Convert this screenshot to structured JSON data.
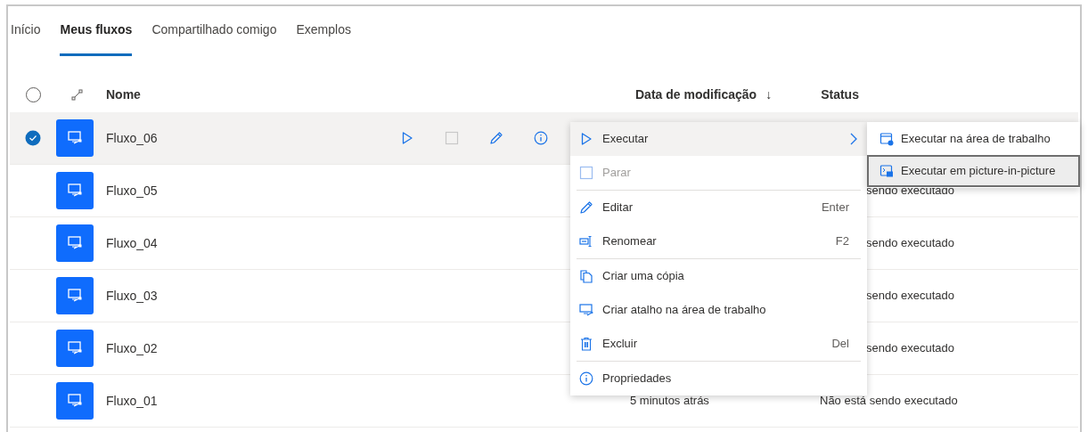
{
  "tabs": [
    {
      "label": "Início",
      "selected": false
    },
    {
      "label": "Meus fluxos",
      "selected": true
    },
    {
      "label": "Compartilhado comigo",
      "selected": false
    },
    {
      "label": "Exemplos",
      "selected": false
    }
  ],
  "table": {
    "columns": {
      "name": "Nome",
      "modified": "Data de modificação",
      "sort_arrow": "↓",
      "status": "Status"
    },
    "select_all_checked": false,
    "rows": [
      {
        "name": "Fluxo_06",
        "selected": true
      },
      {
        "name": "Fluxo_05",
        "selected": false,
        "status": "sendo executado"
      },
      {
        "name": "Fluxo_04",
        "selected": false,
        "status": "sendo executado"
      },
      {
        "name": "Fluxo_03",
        "selected": false,
        "status": "sendo executado"
      },
      {
        "name": "Fluxo_02",
        "selected": false,
        "status": "sendo executado"
      },
      {
        "name": "Fluxo_01",
        "selected": false,
        "modified": "5 minutos atrás",
        "status": "Não está sendo executado"
      }
    ]
  },
  "context_menu": {
    "items": [
      {
        "kind": "item",
        "label": "Executar",
        "highlighted": true,
        "submenu": true,
        "disabled": false
      },
      {
        "kind": "item",
        "label": "Parar",
        "highlighted": false,
        "disabled": true
      },
      {
        "kind": "separator"
      },
      {
        "kind": "item",
        "label": "Editar",
        "shortcut": "Enter",
        "highlighted": false,
        "disabled": false
      },
      {
        "kind": "item",
        "label": "Renomear",
        "shortcut": "F2",
        "highlighted": false,
        "disabled": false
      },
      {
        "kind": "separator"
      },
      {
        "kind": "item",
        "label": "Criar uma cópia",
        "highlighted": false,
        "disabled": false
      },
      {
        "kind": "item",
        "label": "Criar atalho na área de trabalho",
        "highlighted": false,
        "disabled": false
      },
      {
        "kind": "item",
        "label": "Excluir",
        "shortcut": "Del",
        "highlighted": false,
        "disabled": false
      },
      {
        "kind": "separator"
      },
      {
        "kind": "item",
        "label": "Propriedades",
        "highlighted": false,
        "disabled": false
      }
    ]
  },
  "submenu": {
    "items": [
      {
        "label": "Executar na área de trabalho",
        "highlighted": false
      },
      {
        "label": "Executar em picture-in-picture",
        "highlighted": true
      }
    ]
  }
}
